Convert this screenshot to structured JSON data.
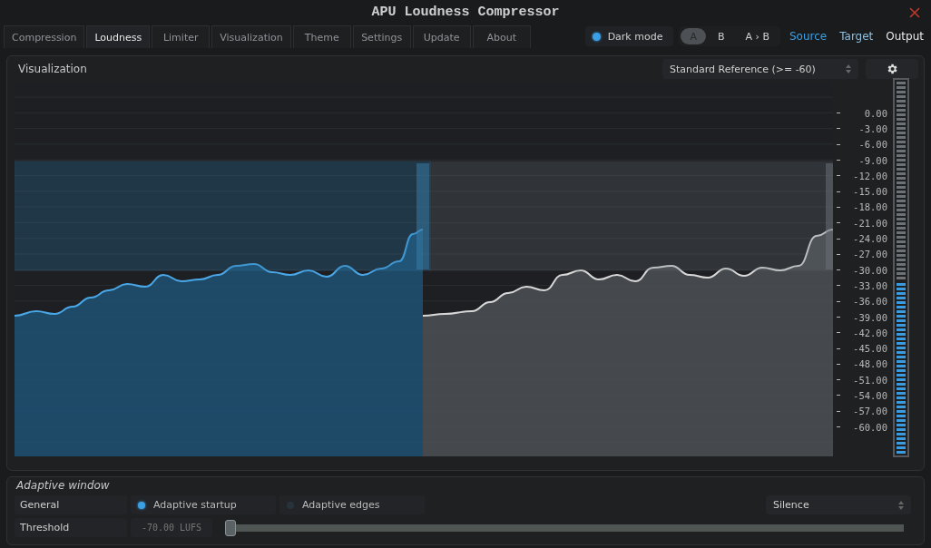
{
  "window": {
    "title": "APU Loudness Compressor"
  },
  "tabs": [
    {
      "label": "Compression",
      "selected": false
    },
    {
      "label": "Loudness",
      "selected": true
    },
    {
      "label": "Limiter",
      "selected": false
    },
    {
      "label": "Visualization",
      "selected": false
    },
    {
      "label": "Theme",
      "selected": false
    },
    {
      "label": "Settings",
      "selected": false
    },
    {
      "label": "Update",
      "selected": false
    },
    {
      "label": "About",
      "selected": false
    }
  ],
  "dark_mode": {
    "label": "Dark mode",
    "on": true
  },
  "ab_buttons": [
    {
      "label": "A",
      "selected": true
    },
    {
      "label": "B",
      "selected": false
    },
    {
      "label": "A › B",
      "selected": false
    }
  ],
  "views": [
    {
      "label": "Source",
      "color": "#3aa0e6"
    },
    {
      "label": "Target",
      "color": "#8fbfe0"
    },
    {
      "label": "Output",
      "color": "#e6e6e6"
    }
  ],
  "visualization": {
    "title": "Visualization",
    "reference": "Standard Reference (>= -60)",
    "scale": [
      "0.00",
      "-3.00",
      "-6.00",
      "-9.00",
      "-12.00",
      "-15.00",
      "-18.00",
      "-21.00",
      "-24.00",
      "-27.00",
      "-30.00",
      "-33.00",
      "-36.00",
      "-39.00",
      "-42.00",
      "-45.00",
      "-48.00",
      "-51.00",
      "-54.00",
      "-57.00",
      "-60.00"
    ],
    "meter": {
      "level": 0.46
    }
  },
  "adaptive_window": {
    "title": "Adaptive window",
    "general_label": "General",
    "options": [
      {
        "label": "Adaptive startup",
        "checked": true
      },
      {
        "label": "Adaptive edges",
        "checked": false
      }
    ],
    "mode": "Silence",
    "threshold_label": "Threshold",
    "threshold_value": "-70.00 LUFS",
    "threshold": {
      "level": 0
    }
  }
}
